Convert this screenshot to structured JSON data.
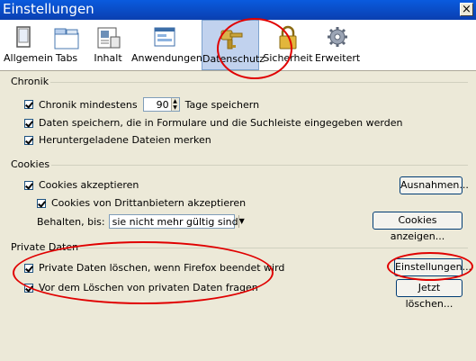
{
  "window": {
    "title": "Einstellungen",
    "close": "×"
  },
  "toolbar": {
    "items": [
      {
        "label": "Allgemein",
        "icon": "monitor-icon"
      },
      {
        "label": "Tabs",
        "icon": "tabs-icon"
      },
      {
        "label": "Inhalt",
        "icon": "content-icon"
      },
      {
        "label": "Anwendungen",
        "icon": "applications-icon"
      },
      {
        "label": "Datenschutz",
        "icon": "privacy-key-icon"
      },
      {
        "label": "Sicherheit",
        "icon": "lock-icon"
      },
      {
        "label": "Erweitert",
        "icon": "gear-icon"
      }
    ],
    "selected": "Datenschutz"
  },
  "chronik": {
    "legend": "Chronik",
    "history_prefix": "Chronik mindestens",
    "history_value": "90",
    "history_suffix": "Tage speichern",
    "forms": "Daten speichern, die in Formulare und die Suchleiste eingegeben werden",
    "downloads": "Heruntergeladene Dateien merken"
  },
  "cookies": {
    "legend": "Cookies",
    "accept": "Cookies akzeptieren",
    "third_party": "Cookies von Drittanbietern akzeptieren",
    "keep_label": "Behalten, bis:",
    "keep_value": "sie nicht mehr gültig sind",
    "exceptions_button": "Ausnahmen...",
    "show_button": "Cookies anzeigen..."
  },
  "private": {
    "legend": "Private Daten",
    "clear_on_exit": "Private Daten löschen, wenn Firefox beendet wird",
    "ask_before": "Vor dem Löschen von privaten Daten fragen",
    "settings_button": "Einstellungen...",
    "clear_now_button": "Jetzt löschen..."
  },
  "colors": {
    "annotation": "#E00000",
    "titlebar": "#0A5BDE"
  }
}
